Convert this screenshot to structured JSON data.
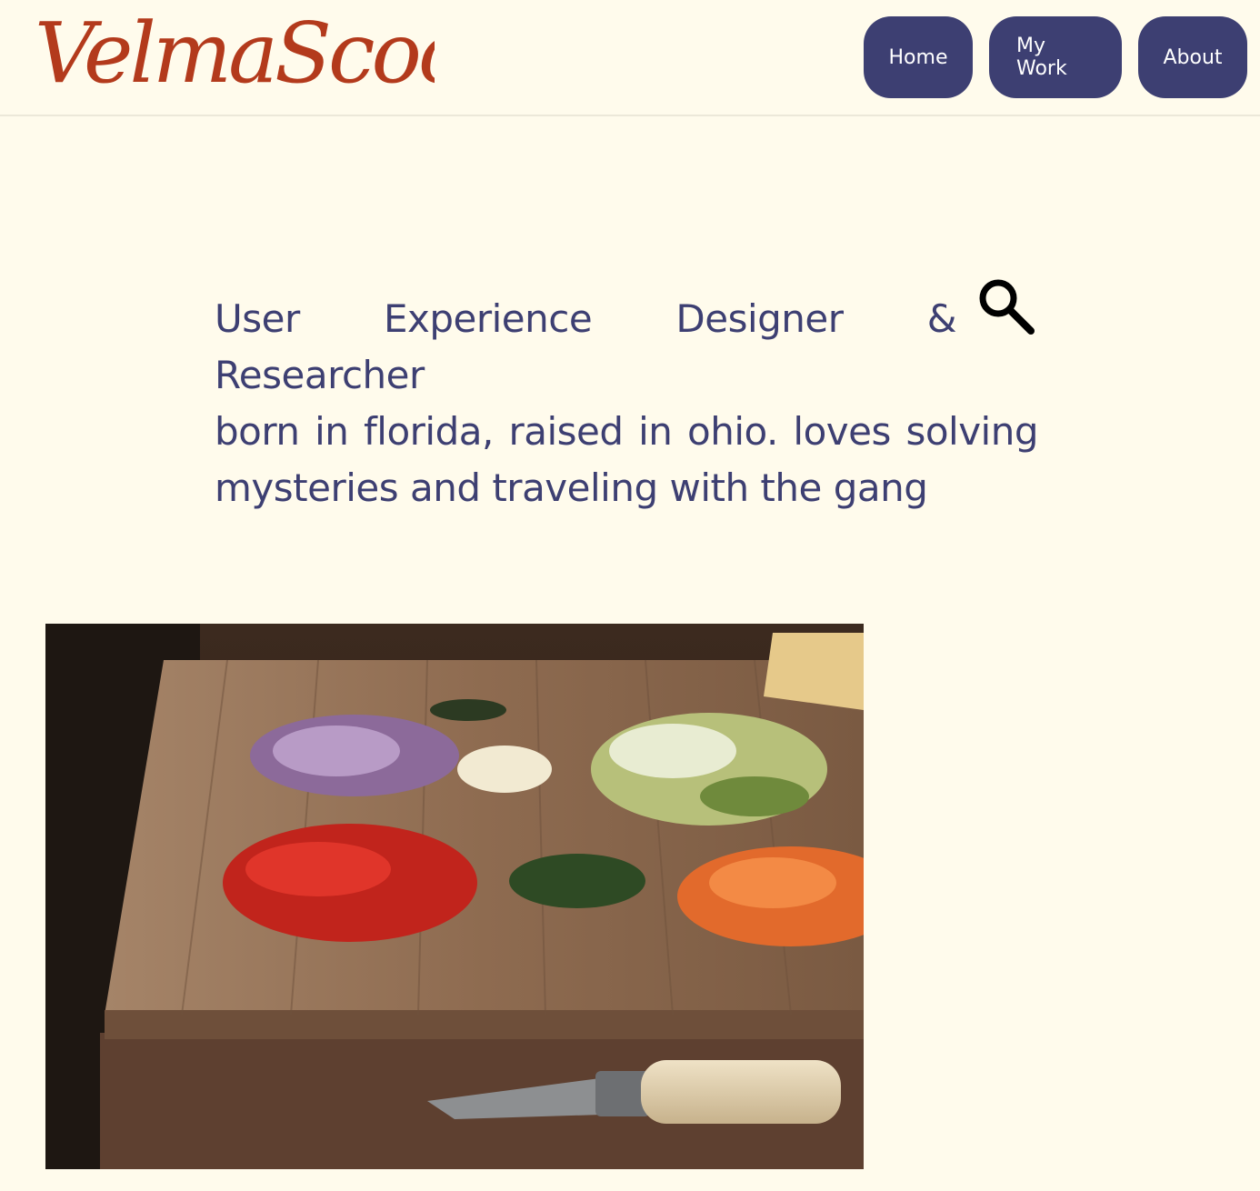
{
  "header": {
    "logo_text": "VelmaScoob",
    "nav": {
      "home": "Home",
      "my_work": "My Work",
      "about": "About"
    }
  },
  "intro": {
    "title": "User Experience Designer & Researcher",
    "bio_line_1": "born in florida, raised in ohio. loves solving",
    "bio_line_2": "mysteries and traveling with the gang",
    "icon": "magnifying-glass-icon"
  },
  "hero": {
    "image_subject": "chopped vegetables on a wooden cutting board with a knife"
  },
  "colors": {
    "background": "#fffbec",
    "accent": "#3d3f72",
    "logo": "#b33a1c"
  }
}
